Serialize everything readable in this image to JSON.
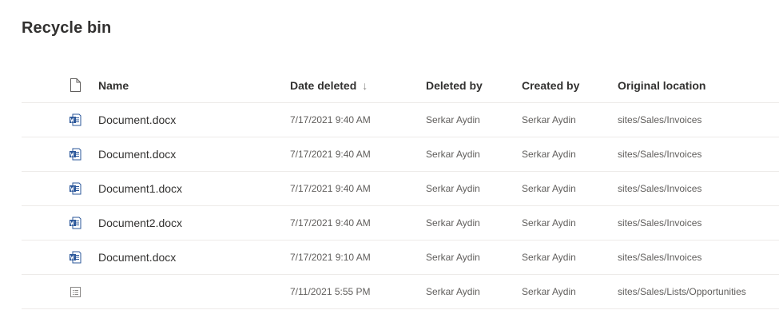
{
  "page": {
    "title": "Recycle bin"
  },
  "table": {
    "columns": {
      "name": "Name",
      "date_deleted": "Date deleted",
      "sort_indicator": "↓",
      "deleted_by": "Deleted by",
      "created_by": "Created by",
      "original_location": "Original location"
    },
    "rows": [
      {
        "icon": "word-document-icon",
        "name": "Document.docx",
        "date_deleted": "7/17/2021 9:40 AM",
        "deleted_by": "Serkar Aydin",
        "created_by": "Serkar Aydin",
        "original_location": "sites/Sales/Invoices"
      },
      {
        "icon": "word-document-icon",
        "name": "Document.docx",
        "date_deleted": "7/17/2021 9:40 AM",
        "deleted_by": "Serkar Aydin",
        "created_by": "Serkar Aydin",
        "original_location": "sites/Sales/Invoices"
      },
      {
        "icon": "word-document-icon",
        "name": "Document1.docx",
        "date_deleted": "7/17/2021 9:40 AM",
        "deleted_by": "Serkar Aydin",
        "created_by": "Serkar Aydin",
        "original_location": "sites/Sales/Invoices"
      },
      {
        "icon": "word-document-icon",
        "name": "Document2.docx",
        "date_deleted": "7/17/2021 9:40 AM",
        "deleted_by": "Serkar Aydin",
        "created_by": "Serkar Aydin",
        "original_location": "sites/Sales/Invoices"
      },
      {
        "icon": "word-document-icon",
        "name": "Document.docx",
        "date_deleted": "7/17/2021 9:10 AM",
        "deleted_by": "Serkar Aydin",
        "created_by": "Serkar Aydin",
        "original_location": "sites/Sales/Invoices"
      },
      {
        "icon": "list-item-icon",
        "name": "",
        "date_deleted": "7/11/2021 5:55 PM",
        "deleted_by": "Serkar Aydin",
        "created_by": "Serkar Aydin",
        "original_location": "sites/Sales/Lists/Opportunities"
      }
    ]
  },
  "colors": {
    "word_blue": "#2b579a",
    "divider": "#edebe9",
    "text": "#323130",
    "muted": "#605e5c"
  }
}
